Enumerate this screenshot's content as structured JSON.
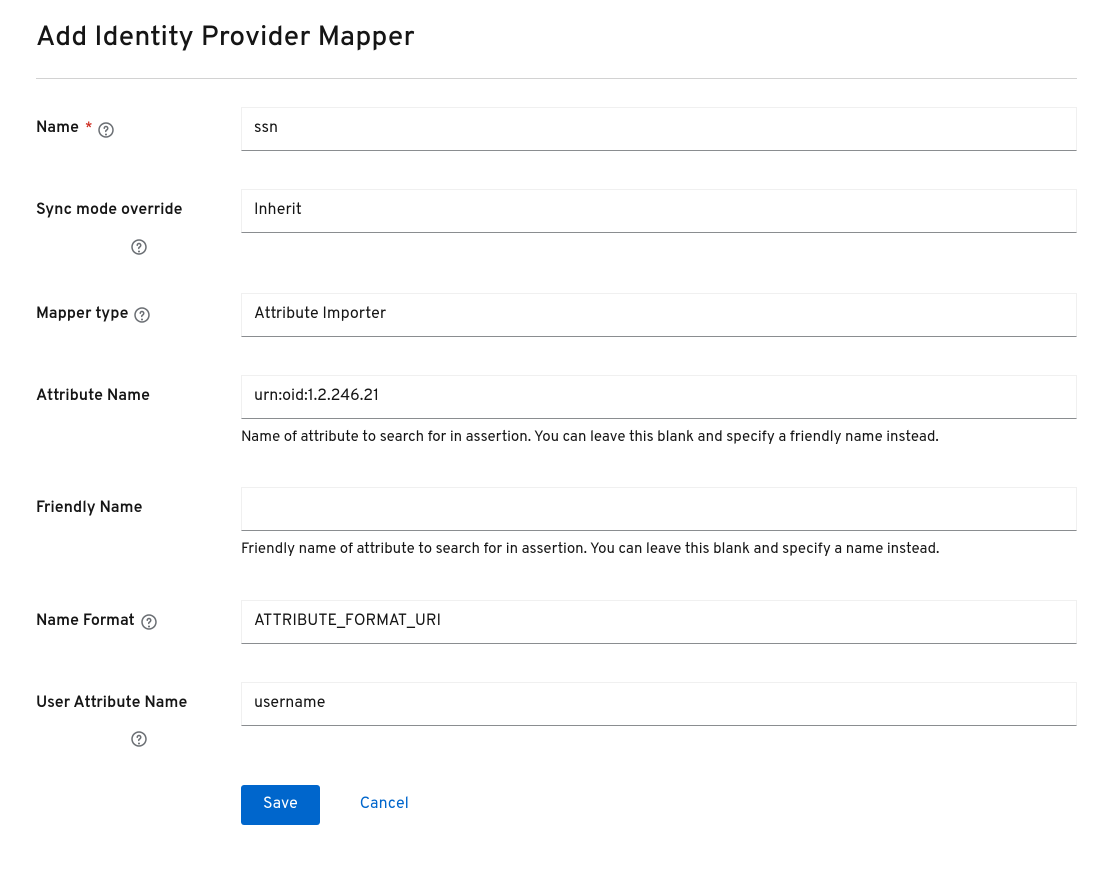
{
  "page": {
    "title": "Add Identity Provider Mapper"
  },
  "form": {
    "name": {
      "label": "Name",
      "value": "ssn"
    },
    "sync_mode": {
      "label": "Sync mode override",
      "value": "Inherit"
    },
    "mapper_type": {
      "label": "Mapper type",
      "value": "Attribute Importer"
    },
    "attribute_name": {
      "label": "Attribute Name",
      "value": "urn:oid:1.2.246.21",
      "help": "Name of attribute to search for in assertion. You can leave this blank and specify a friendly name instead."
    },
    "friendly_name": {
      "label": "Friendly Name",
      "value": "",
      "help": "Friendly name of attribute to search for in assertion. You can leave this blank and specify a name instead."
    },
    "name_format": {
      "label": "Name Format",
      "value": "ATTRIBUTE_FORMAT_URI"
    },
    "user_attribute_name": {
      "label": "User Attribute Name",
      "value": "username"
    }
  },
  "actions": {
    "save": "Save",
    "cancel": "Cancel"
  }
}
